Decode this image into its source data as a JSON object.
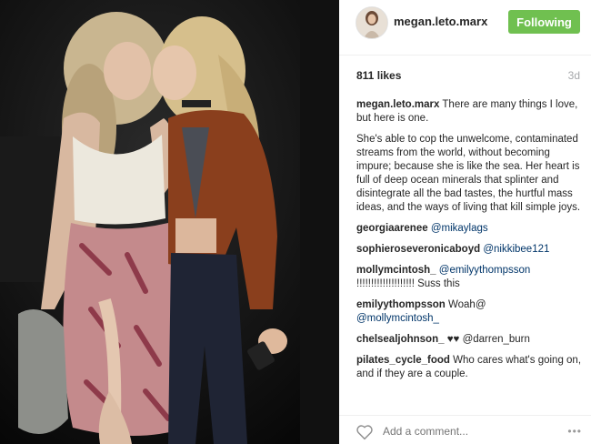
{
  "post": {
    "username": "megan.leto.marx",
    "follow_label": "Following",
    "likes": "811 likes",
    "time_ago": "3d",
    "caption_text": "There are many things I love, but here is one.",
    "caption_body": "She's able to cop the unwelcome, contaminated streams from the world, without becoming impure; because she is like the sea. Her heart is full of deep ocean minerals that splinter and disintegrate all the bad tastes, the hurtful mass ideas, and the ways of living that kill simple joys."
  },
  "comments": [
    {
      "user": "georgiaarenee",
      "text": "@mikaylags"
    },
    {
      "user": "sophieroseveronicaboyd",
      "text": "@nikkibee121"
    },
    {
      "user": "mollymcintosh_",
      "text": "@emilyythompsson",
      "text2": "!!!!!!!!!!!!!!!!!!!! Suss this"
    },
    {
      "user": "emilyythompsson",
      "text": "Woah@",
      "text2": "@mollymcintosh_"
    },
    {
      "user": "chelsealjohnson_",
      "text": "♥♥ @darren_burn"
    },
    {
      "user": "pilates_cycle_food",
      "text": "Who cares what's going on, and if they are a couple."
    }
  ],
  "add_comment": {
    "placeholder": "Add a comment..."
  },
  "more_label": "•••",
  "colors": {
    "follow": "#70c050",
    "mention": "#003569"
  }
}
